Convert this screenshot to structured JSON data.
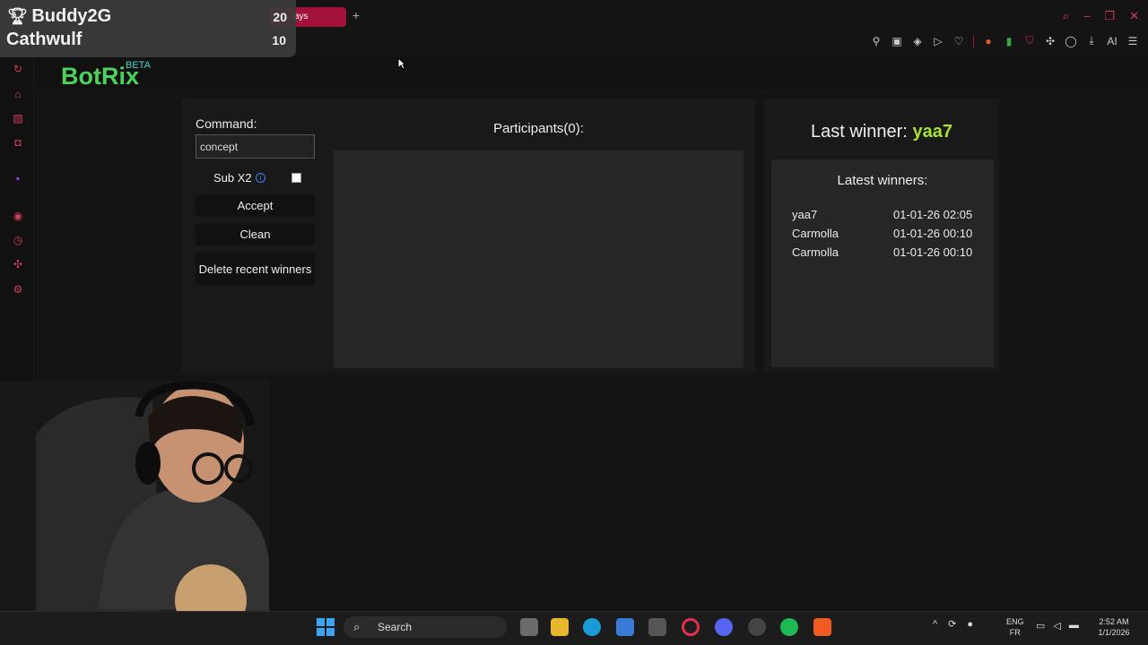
{
  "overlay": {
    "leaderboard": [
      {
        "name": "Buddy2G",
        "score": "20"
      },
      {
        "name": "Cathwulf",
        "score": "10"
      }
    ]
  },
  "browser": {
    "tab_title_fragment": "ays",
    "new_tab": "+",
    "ai_label": "AI"
  },
  "app": {
    "logo": "BotRix",
    "beta_badge": "BETA"
  },
  "giveaway": {
    "command_label": "Command:",
    "command_value": "concept",
    "sub_label": "Sub X2",
    "sub_checked": false,
    "accept_label": "Accept",
    "clean_label": "Clean",
    "delete_label": "Delete recent winners",
    "participants_title": "Participants(0):"
  },
  "winners": {
    "last_winner_label": "Last winner:",
    "last_winner_name": "yaa7",
    "latest_title": "Latest winners:",
    "list": [
      {
        "name": "yaa7",
        "date": "01-01-26 02:05"
      },
      {
        "name": "Carmolla",
        "date": "01-01-26 00:10"
      },
      {
        "name": "Carmolla",
        "date": "01-01-26 00:10"
      }
    ]
  },
  "taskbar": {
    "search_label": "Search",
    "lang_top": "ENG",
    "lang_bottom": "FR",
    "time": "2:52 AM",
    "date": "1/1/2026"
  },
  "colors": {
    "brand_green": "#4cd25a",
    "winner_green": "#a6e22e",
    "tab_red": "#a3123a"
  }
}
